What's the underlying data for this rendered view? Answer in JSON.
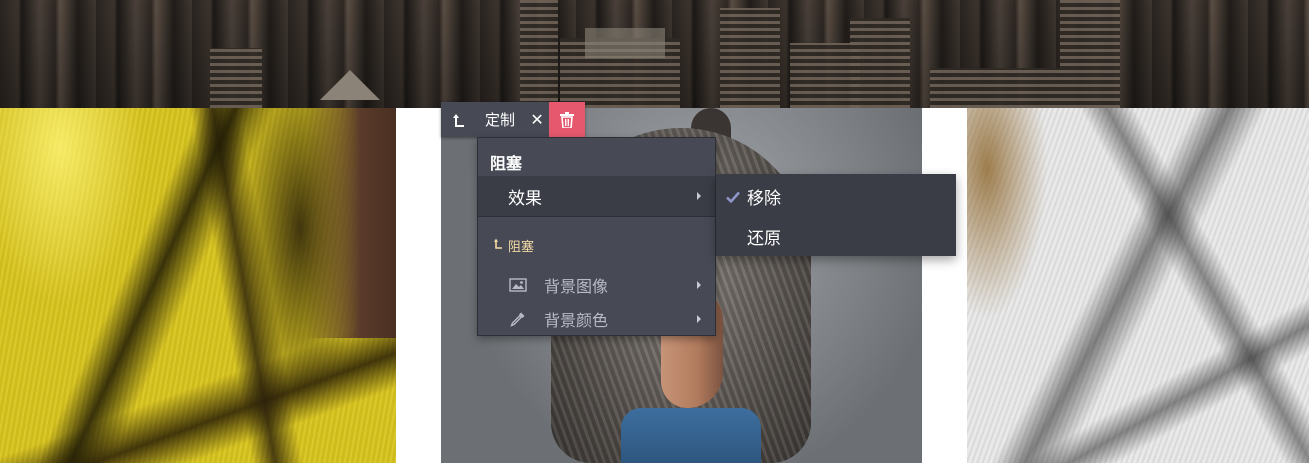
{
  "toolbar": {
    "customize_label": "定制",
    "close_glyph": "✕"
  },
  "menu": {
    "title": "阻塞",
    "effect_label": "效果",
    "parent_label": "阻塞",
    "bg_image_label": "背景图像",
    "bg_color_label": "背景颜色"
  },
  "submenu": {
    "remove_label": "移除",
    "restore_label": "还原",
    "selected": "移除"
  },
  "colors": {
    "toolbar_bg": "#474a55",
    "menu_bg": "#474a55",
    "menu_active_bg": "#3b3d46",
    "delete_red": "#e6586e",
    "parent_link": "#f4d9a5",
    "check_accent": "#8e95c9"
  },
  "icons": [
    "parent-up-icon",
    "close-icon",
    "trash-icon",
    "chevron-right-icon",
    "image-icon",
    "eyedropper-icon",
    "checkmark-icon"
  ]
}
